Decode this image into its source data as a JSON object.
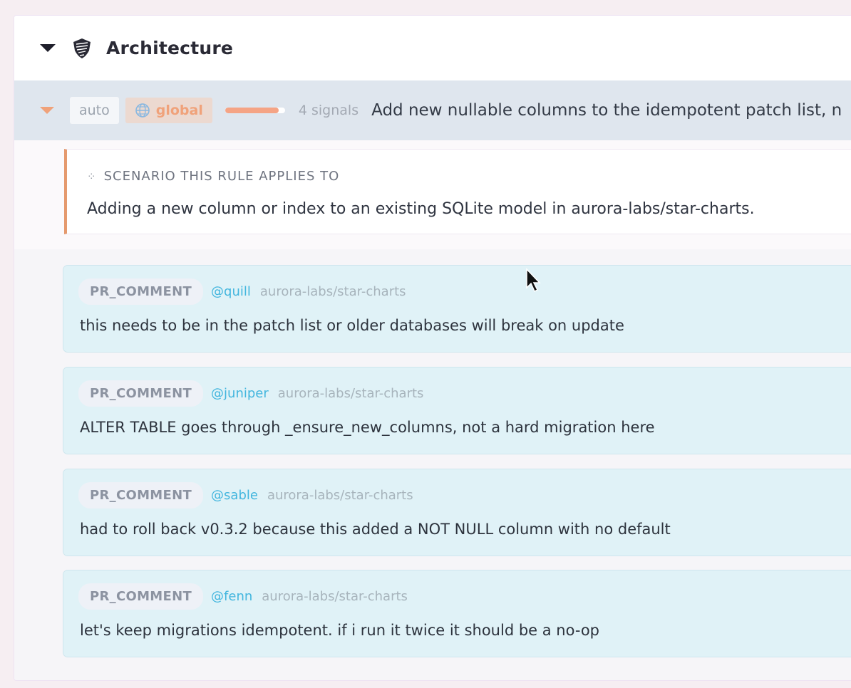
{
  "section": {
    "title": "Architecture",
    "icon": "shield-icon"
  },
  "rule": {
    "mode_tag": "auto",
    "scope_tag": "global",
    "confidence": 0.9,
    "signals": "4 signals",
    "text": "Add new nullable columns to the idempotent patch list, n",
    "accent_color": "#f0a27a"
  },
  "scenario": {
    "label": "SCENARIO THIS RULE APPLIES TO",
    "text": "Adding a new column or index to an existing SQLite model in aurora-labs/star-charts."
  },
  "comments": [
    {
      "kind": "PR_COMMENT",
      "author": "@quill",
      "repo": "aurora-labs/star-charts",
      "text": "this needs to be in the patch list or older databases will break on update"
    },
    {
      "kind": "PR_COMMENT",
      "author": "@juniper",
      "repo": "aurora-labs/star-charts",
      "text": "ALTER TABLE goes through _ensure_new_columns, not a hard migration here"
    },
    {
      "kind": "PR_COMMENT",
      "author": "@sable",
      "repo": "aurora-labs/star-charts",
      "text": "had to roll back v0.3.2 because this added a NOT NULL column with no default"
    },
    {
      "kind": "PR_COMMENT",
      "author": "@fenn",
      "repo": "aurora-labs/star-charts",
      "text": "let's keep migrations idempotent. if i run it twice it should be a no-op"
    }
  ]
}
